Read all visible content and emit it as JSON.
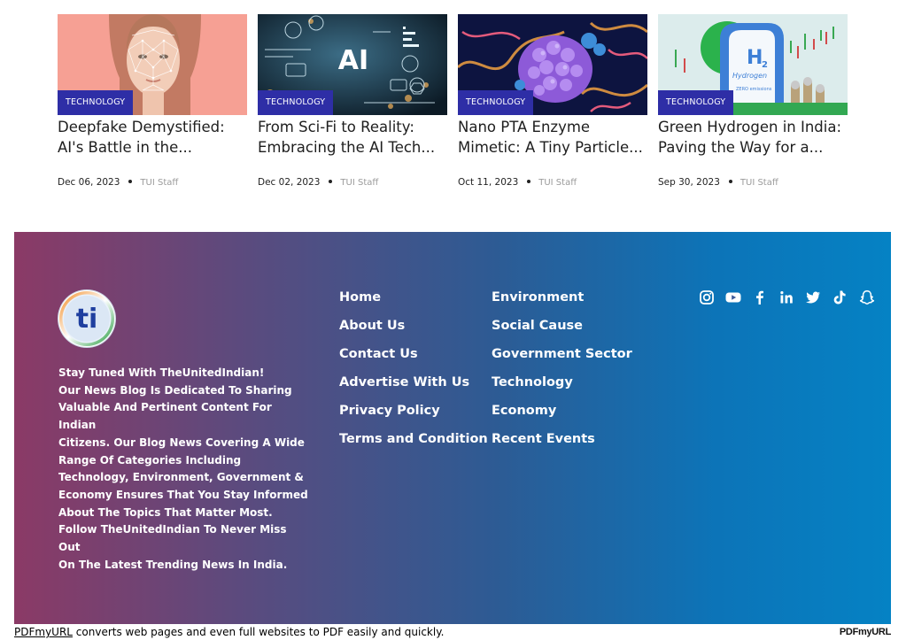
{
  "articles": [
    {
      "category": "TECHNOLOGY",
      "title": "Deepfake Demystified: AI's Battle in the...",
      "date": "Dec 06, 2023",
      "author": "TUI Staff"
    },
    {
      "category": "TECHNOLOGY",
      "title": "From Sci-Fi to Reality: Embracing the AI Tech...",
      "date": "Dec 02, 2023",
      "author": "TUI Staff"
    },
    {
      "category": "TECHNOLOGY",
      "title": "Nano PTA Enzyme Mimetic: A Tiny Particle...",
      "date": "Oct 11, 2023",
      "author": "TUI Staff"
    },
    {
      "category": "TECHNOLOGY",
      "title": "Green Hydrogen in India: Paving the Way for a...",
      "date": "Sep 30, 2023",
      "author": "TUI Staff"
    }
  ],
  "thumbnail_text": {
    "ai": "AI",
    "h2": "H",
    "h2_sub": "2",
    "hydrogen": "Hydrogen",
    "zero_emissions": "ZERO emissions"
  },
  "footer": {
    "logo_text": "ti",
    "about_lines": [
      "Stay Tuned With TheUnitedIndian!",
      "Our News Blog Is Dedicated To Sharing",
      "Valuable And Pertinent Content For Indian",
      "Citizens. Our Blog News Covering A Wide",
      "Range Of Categories Including",
      "Technology, Environment, Government &",
      "Economy Ensures That You Stay Informed",
      "About The Topics That Matter Most.",
      "Follow TheUnitedIndian To Never Miss Out",
      "On The Latest Trending News In India."
    ],
    "links_col1": [
      "Home",
      "About Us",
      "Contact Us",
      "Advertise With Us",
      "Privacy Policy",
      "Terms and Condition"
    ],
    "links_col2": [
      "Environment",
      "Social Cause",
      "Government Sector",
      "Technology",
      "Economy",
      "Recent Events"
    ],
    "social_icons": [
      "instagram-icon",
      "youtube-icon",
      "facebook-icon",
      "linkedin-icon",
      "twitter-icon",
      "tiktok-icon",
      "snapchat-icon"
    ]
  },
  "pdf_bar": {
    "link": "PDFmyURL",
    "text": " converts web pages and even full websites to PDF easily and quickly.",
    "logo": "PDFmyURL"
  },
  "colors": {
    "badge": "#2e2ea6",
    "footer_gradient_start": "#8b3a66",
    "footer_gradient_end": "#0582c4"
  }
}
